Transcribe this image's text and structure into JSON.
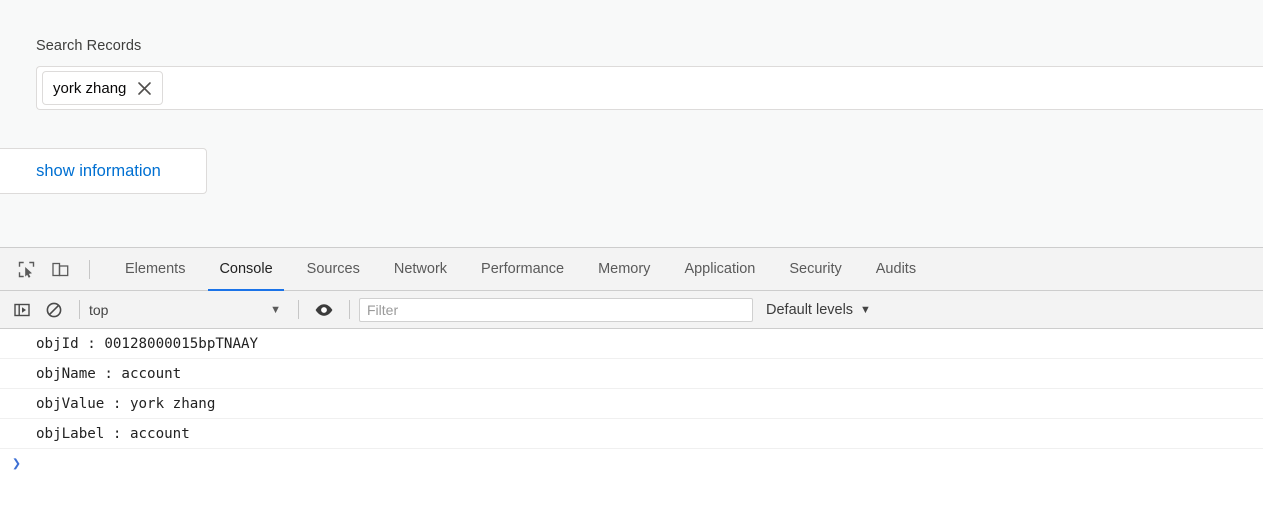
{
  "page": {
    "search_label": "Search Records",
    "search_pill_value": "york zhang",
    "search_pill_remove_icon": "close-x-icon",
    "show_information_label": "show information"
  },
  "devtools": {
    "inspect_icon": "inspect-element-icon",
    "device_toolbar_icon": "device-toggle-icon",
    "tabs": [
      {
        "label": "Elements",
        "active": false
      },
      {
        "label": "Console",
        "active": true
      },
      {
        "label": "Sources",
        "active": false
      },
      {
        "label": "Network",
        "active": false
      },
      {
        "label": "Performance",
        "active": false
      },
      {
        "label": "Memory",
        "active": false
      },
      {
        "label": "Application",
        "active": false
      },
      {
        "label": "Security",
        "active": false
      },
      {
        "label": "Audits",
        "active": false
      }
    ],
    "console_toolbar": {
      "sidebar_toggle_icon": "console-sidebar-icon",
      "clear_console_icon": "clear-console-icon",
      "context_value": "top",
      "context_caret": "▼",
      "eye_icon": "live-expression-eye-icon",
      "filter_placeholder": "Filter",
      "filter_value": "",
      "levels_label": "Default levels",
      "levels_caret": "▼"
    },
    "console_messages": [
      "objId : 00128000015bpTNAAY",
      "objName : account",
      "objValue : york zhang",
      "objLabel : account"
    ],
    "prompt_caret": "❯"
  },
  "colors": {
    "accent_blue": "#1a73e8",
    "link_blue": "#0070d2",
    "prompt_blue": "#3d6fd4",
    "page_bg": "#f8f9f9",
    "toolbar_bg": "#f3f3f3",
    "border": "#cdcdcd"
  }
}
